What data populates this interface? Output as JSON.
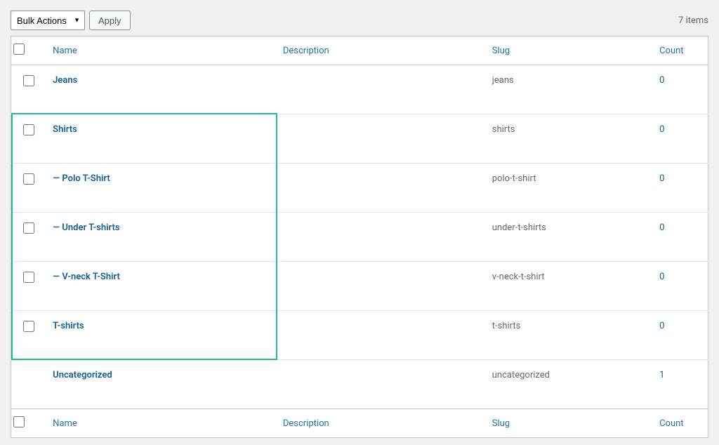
{
  "tablenav": {
    "bulk_placeholder": "Bulk Actions",
    "apply_label": "Apply",
    "item_count": "7 items"
  },
  "columns": {
    "name": "Name",
    "description": "Description",
    "slug": "Slug",
    "count": "Count"
  },
  "rows": [
    {
      "name": "Jeans",
      "slug": "jeans",
      "count": "0",
      "has_checkbox": true
    },
    {
      "name": "Shirts",
      "slug": "shirts",
      "count": "0",
      "has_checkbox": true
    },
    {
      "name": "— Polo T-Shirt",
      "slug": "polo-t-shirt",
      "count": "0",
      "has_checkbox": true
    },
    {
      "name": "— Under T-shirts",
      "slug": "under-t-shirts",
      "count": "0",
      "has_checkbox": true
    },
    {
      "name": "— V-neck T-Shirt",
      "slug": "v-neck-t-shirt",
      "count": "0",
      "has_checkbox": true
    },
    {
      "name": "T-shirts",
      "slug": "t-shirts",
      "count": "0",
      "has_checkbox": true
    },
    {
      "name": "Uncategorized",
      "slug": "uncategorized",
      "count": "1",
      "has_checkbox": false
    }
  ]
}
